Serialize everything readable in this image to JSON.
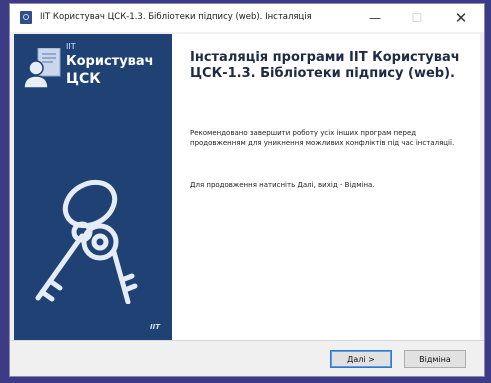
{
  "window": {
    "title": "IIT Користувач ЦСК-1.3. Бібліотеки підпису (web). Інсталяція",
    "minimize_glyph": "—",
    "maximize_glyph": "☐",
    "close_glyph": "✕"
  },
  "sidebar": {
    "logo_brand": "IIT",
    "logo_line1": "Користувач",
    "logo_line2": "ЦСК",
    "footer_brand": "IIT",
    "icons": [
      "user-certificate-icon",
      "keys-icon"
    ],
    "background_color": "#1f4174"
  },
  "content": {
    "heading": "Інсталяція програми IIT Користувач ЦСК-1.3. Бібліотеки підпису (web).",
    "paragraph1": "Рекомендовано завершити роботу усіх інших програм перед продовженням для уникнення можливих конфліктів під час інсталяції.",
    "paragraph2": "Для продовження натисніть Далі, вихід - Відміна."
  },
  "buttons": {
    "next": "Далі >",
    "cancel": "Відміна"
  }
}
